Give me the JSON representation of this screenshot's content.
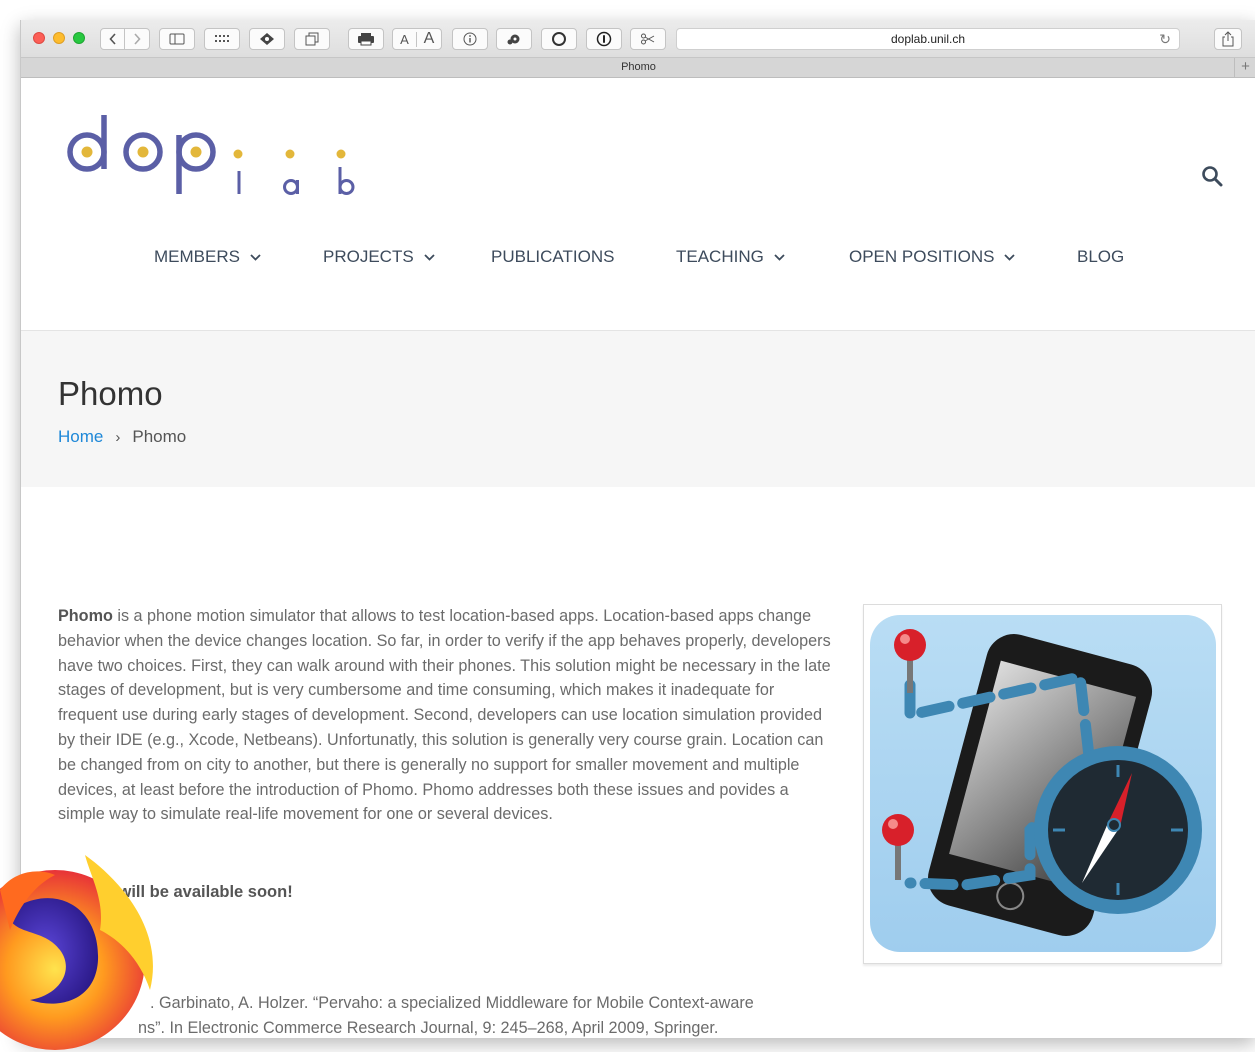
{
  "browser": {
    "url": "doplab.unil.ch",
    "tab_title": "Phomo",
    "font_small": "A",
    "font_large": "A"
  },
  "site": {
    "logo_text": "doplab",
    "nav": [
      {
        "label": "MEMBERS",
        "has_dropdown": true
      },
      {
        "label": "PROJECTS",
        "has_dropdown": true
      },
      {
        "label": "PUBLICATIONS",
        "has_dropdown": false
      },
      {
        "label": "TEACHING",
        "has_dropdown": true
      },
      {
        "label": "OPEN POSITIONS",
        "has_dropdown": true
      },
      {
        "label": "BLOG",
        "has_dropdown": false
      }
    ]
  },
  "header": {
    "title": "Phomo",
    "breadcrumb_home": "Home",
    "breadcrumb_sep": "›",
    "breadcrumb_current": "Phomo"
  },
  "content": {
    "intro_bold": "Phomo",
    "intro_text": " is a phone motion simulator that allows to test location-based apps. Location-based apps change behavior when the device changes location. So far, in order to verify if the app behaves properly, developers have two choices. First, they can walk around with their phones. This solution might be necessary in the late stages of development, but is very cumbersome and time consuming, which makes it inadequate for frequent use during early stages of development. Second, developers can use location simulation provided by their IDE (e.g., Xcode, Netbeans). Unfortunatly, this solution is generally very course grain. Location can be changed from on city to another, but there is generally no support for smaller movement and multiple devices, at least before the introduction of Phomo. Phomo addresses both these issues and povides a simple way to simulate real-life movement for one or several devices.",
    "availability": "Phomo will be available soon!",
    "reference": "[partially hidden] Garbinato, A. Holzer. “Pervaho: a specialized Middleware for Mobile Context-aware Applications”. In Electronic Commerce Research Journal, 9: 245–268, April 2009, Springer.",
    "reference_visible_line1": ". Garbinato, A. Holzer. “Pervaho: a specialized Middleware for Mobile Context-aware",
    "reference_visible_line2": "ns”. In Electronic Commerce Research Journal, 9: 245–268, April 2009, Springer."
  },
  "colors": {
    "accent_link": "#1e88d8",
    "logo_purple": "#5b5fa6",
    "logo_yellow": "#e3b73a",
    "nav_text": "#3d4b5c"
  },
  "icons": [
    "back-icon",
    "forward-icon",
    "sidebar-icon",
    "grid-icon",
    "tag-icon",
    "tabs-icon",
    "print-icon",
    "info-icon",
    "gear-icon",
    "circle-icon",
    "password-icon",
    "scissors-icon",
    "reload-icon",
    "share-icon",
    "search-icon",
    "chevron-down-icon",
    "firefox-logo"
  ]
}
